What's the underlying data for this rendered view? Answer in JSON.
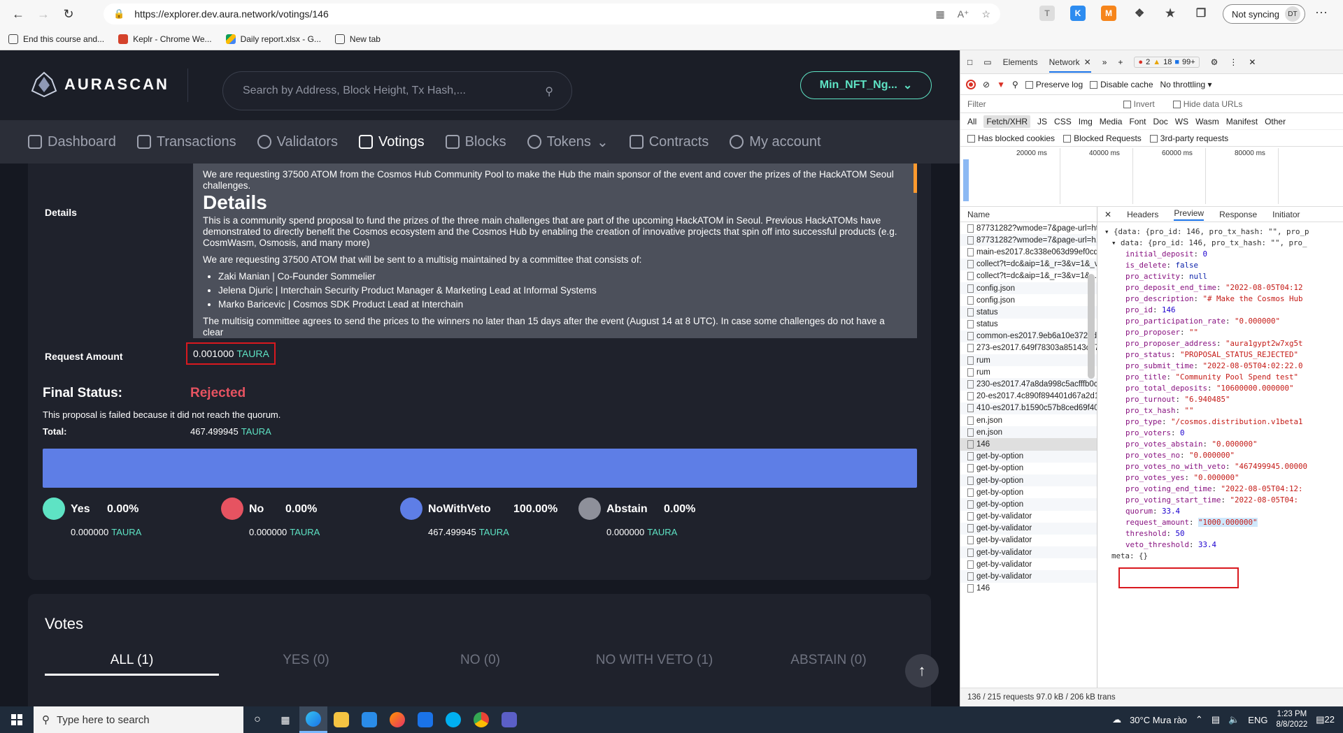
{
  "browser": {
    "url": "https://explorer.dev.aura.network/votings/146",
    "sync_label": "Not syncing",
    "avatar": "DT",
    "bookmarks": [
      "End this course and...",
      "Keplr - Chrome We...",
      "Daily report.xlsx - G...",
      "New tab"
    ]
  },
  "app": {
    "logo_text": "AURASCAN",
    "search_placeholder": "Search by Address, Block Height, Tx Hash,...",
    "wallet_label": "Min_NFT_Ng...",
    "nav": [
      "Dashboard",
      "Transactions",
      "Validators",
      "Votings",
      "Blocks",
      "Tokens",
      "Contracts",
      "My account"
    ],
    "details_label": "Details",
    "description": {
      "p1": "We are requesting 37500 ATOM from the Cosmos Hub Community Pool to make the Hub the main sponsor of the event and cover the prizes of the HackATOM Seoul challenges.",
      "heading": "Details",
      "p2": "This is a community spend proposal to fund the prizes of the three main challenges that are part of the upcoming HackATOM in Seoul. Previous HackATOMs have demonstrated to directly benefit the Cosmos ecosystem and the Cosmos Hub by enabling the creation of innovative projects that spin off into successful products (e.g. CosmWasm, Osmosis, and many more)",
      "p3": "We are requesting 37500 ATOM that will be sent to a multisig maintained by a committee that consists of:",
      "list": [
        "Zaki Manian | Co-Founder Sommelier",
        "Jelena Djuric | Interchain Security Product Manager & Marketing Lead at Informal Systems",
        "Marko Baricevic | Cosmos SDK Product Lead at Interchain"
      ],
      "p4": "The multisig committee agrees to send the prices to the winners no later than 15 days after the event (August 14 at 8 UTC). In case some challenges do not have a clear"
    },
    "request_amount_label": "Request Amount",
    "request_amount_value": "0.001000",
    "denom": "TAURA",
    "final_status_label": "Final Status:",
    "final_status_value": "Rejected",
    "status_note": "This proposal is failed because it did not reach the quorum.",
    "total_label": "Total:",
    "total_value": "467.499945",
    "votes": [
      {
        "name": "Yes",
        "pct": "0.00%",
        "amount": "0.000000",
        "color": "#5ee3c4"
      },
      {
        "name": "No",
        "pct": "0.00%",
        "amount": "0.000000",
        "color": "#e65361"
      },
      {
        "name": "NoWithVeto",
        "pct": "100.00%",
        "amount": "467.499945",
        "color": "#5e7ee6"
      },
      {
        "name": "Abstain",
        "pct": "0.00%",
        "amount": "0.000000",
        "color": "#8e909a"
      }
    ],
    "votes_title": "Votes",
    "vote_tabs": [
      "ALL (1)",
      "YES (0)",
      "NO (0)",
      "NO WITH VETO (1)",
      "ABSTAIN (0)"
    ]
  },
  "devtools": {
    "tabs": [
      "Elements",
      "Network"
    ],
    "errors": "2",
    "warnings": "18",
    "infos": "99+",
    "preserve_log": "Preserve log",
    "disable_cache": "Disable cache",
    "throttling": "No throttling",
    "filter_placeholder": "Filter",
    "invert": "Invert",
    "hide_data_urls": "Hide data URLs",
    "types": [
      "All",
      "Fetch/XHR",
      "JS",
      "CSS",
      "Img",
      "Media",
      "Font",
      "Doc",
      "WS",
      "Wasm",
      "Manifest",
      "Other"
    ],
    "blocked": [
      "Has blocked cookies",
      "Blocked Requests",
      "3rd-party requests"
    ],
    "timeline_labels": [
      "20000 ms",
      "40000 ms",
      "60000 ms",
      "80000 ms"
    ],
    "name_header": "Name",
    "requests": [
      "87731282?wmode=7&page-url=htt...",
      "87731282?wmode=7&page-url=h...",
      "main-es2017.8c338e063d99ef0cd",
      "collect?t=dc&aip=1&_r=3&v=1&_v...",
      "collect?t=dc&aip=1&_r=3&v=1&...",
      "config.json",
      "config.json",
      "status",
      "status",
      "common-es2017.9eb6a10e3726d...",
      "273-es2017.649f78303a85143cb7...",
      "rum",
      "rum",
      "230-es2017.47a8da998c5acfffb0c...",
      "20-es2017.4c890f894401d67a2d1...",
      "410-es2017.b1590c57b8ced69f40...",
      "en.json",
      "en.json",
      "146",
      "get-by-option",
      "get-by-option",
      "get-by-option",
      "get-by-option",
      "get-by-option",
      "get-by-validator",
      "get-by-validator",
      "get-by-validator",
      "get-by-validator",
      "get-by-validator",
      "get-by-validator",
      "146"
    ],
    "preview_tabs": [
      "Headers",
      "Preview",
      "Response",
      "Initiator"
    ],
    "json_root": "{data: {pro_id: 146, pro_tx_hash: \"\", pro_p",
    "json_data": "data: {pro_id: 146, pro_tx_hash: \"\", pro_",
    "fields": [
      {
        "k": "initial_deposit",
        "v": "0",
        "t": "n"
      },
      {
        "k": "is_delete",
        "v": "false",
        "t": "kw"
      },
      {
        "k": "pro_activity",
        "v": "null",
        "t": "kw"
      },
      {
        "k": "pro_deposit_end_time",
        "v": "\"2022-08-05T04:12",
        "t": "s"
      },
      {
        "k": "pro_description",
        "v": "\"# Make the Cosmos Hub",
        "t": "s"
      },
      {
        "k": "pro_id",
        "v": "146",
        "t": "n"
      },
      {
        "k": "pro_participation_rate",
        "v": "\"0.000000\"",
        "t": "s"
      },
      {
        "k": "pro_proposer",
        "v": "\"\"",
        "t": "s"
      },
      {
        "k": "pro_proposer_address",
        "v": "\"aura1gypt2w7xg5t",
        "t": "s"
      },
      {
        "k": "pro_status",
        "v": "\"PROPOSAL_STATUS_REJECTED\"",
        "t": "s"
      },
      {
        "k": "pro_submit_time",
        "v": "\"2022-08-05T04:02:22.0",
        "t": "s"
      },
      {
        "k": "pro_title",
        "v": "\"Community Pool Spend test\"",
        "t": "s"
      },
      {
        "k": "pro_total_deposits",
        "v": "\"10600000.000000\"",
        "t": "s"
      },
      {
        "k": "pro_turnout",
        "v": "\"6.940485\"",
        "t": "s"
      },
      {
        "k": "pro_tx_hash",
        "v": "\"\"",
        "t": "s"
      },
      {
        "k": "pro_type",
        "v": "\"/cosmos.distribution.v1beta1",
        "t": "s"
      },
      {
        "k": "pro_voters",
        "v": "0",
        "t": "n"
      },
      {
        "k": "pro_votes_abstain",
        "v": "\"0.000000\"",
        "t": "s"
      },
      {
        "k": "pro_votes_no",
        "v": "\"0.000000\"",
        "t": "s"
      },
      {
        "k": "pro_votes_no_with_veto",
        "v": "\"467499945.00000",
        "t": "s"
      },
      {
        "k": "pro_votes_yes",
        "v": "\"0.000000\"",
        "t": "s"
      },
      {
        "k": "pro_voting_end_time",
        "v": "\"2022-08-05T04:12:",
        "t": "s"
      },
      {
        "k": "pro_voting_start_time",
        "v": "\"2022-08-05T04:",
        "t": "s"
      },
      {
        "k": "quorum",
        "v": "33.4",
        "t": "n"
      },
      {
        "k": "request_amount",
        "v": "\"1000.000000\"",
        "t": "s"
      },
      {
        "k": "threshold",
        "v": "50",
        "t": "n"
      },
      {
        "k": "veto_threshold",
        "v": "33.4",
        "t": "n"
      }
    ],
    "meta": "meta: {}",
    "status_bar": "136 / 215 requests   97.0 kB / 206 kB trans"
  },
  "taskbar": {
    "search_placeholder": "Type here to search",
    "weather": "30°C  Mưa rào",
    "lang": "ENG",
    "time": "1:23 PM",
    "date": "8/8/2022",
    "notif_count": "22"
  }
}
